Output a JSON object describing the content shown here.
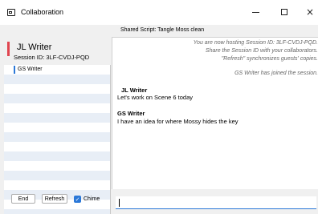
{
  "window": {
    "title": "Collaboration",
    "icon": "app-window-icon",
    "controls": {
      "minimize": "minimize-icon",
      "maximize": "maximize-icon",
      "close": "×"
    }
  },
  "script_bar": {
    "label": "Shared Script: Tangle  Moss clean"
  },
  "sidebar": {
    "host_name": "JL Writer",
    "session_id": "Session ID: 3LF-CVDJ-PQD",
    "users": [
      {
        "name": "GS Writer"
      }
    ],
    "end_label": "End",
    "refresh_label": "Refresh",
    "chime_label": "Chime",
    "chime_checked": "✓",
    "host_color": "#e0454f",
    "accent_color": "#2b78d8"
  },
  "chat": {
    "system_lines": [
      "You are now hosting Session ID: 3LF-CVDJ-PQD.",
      "Share the Session ID with your collaborators.",
      "\"Refresh\" synchronizes guests' copies.",
      "GS Writer has joined the session."
    ],
    "messages": [
      {
        "author": "JL Writer",
        "text": "Let's work on Scene 6 today"
      },
      {
        "author": "GS Writer",
        "text": "I have an idea for where Mossy hides the key"
      }
    ]
  },
  "input": {
    "value": "",
    "placeholder": ""
  }
}
